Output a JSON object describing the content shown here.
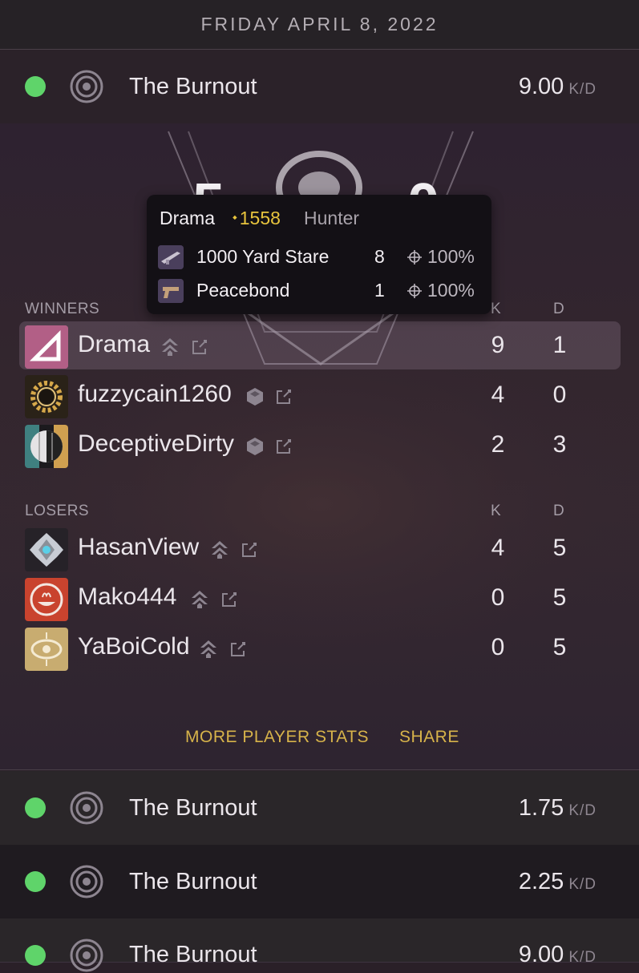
{
  "date": "FRIDAY APRIL 8, 2022",
  "activities_top": [
    {
      "map": "The Burnout",
      "kd": "9.00",
      "kd_unit": "K/D",
      "status_color": "#5fd46a"
    }
  ],
  "match": {
    "score_left": "5",
    "score_right": "0",
    "winners_label": "WINNERS",
    "losers_label": "LOSERS",
    "k_label": "K",
    "d_label": "D",
    "winners": [
      {
        "name": "Drama",
        "k": "9",
        "d": "1",
        "platform_icon": "hunter-class-icon",
        "highlighted": true
      },
      {
        "name": "fuzzycain1260",
        "k": "4",
        "d": "0",
        "platform_icon": "steam-icon",
        "highlighted": false
      },
      {
        "name": "DeceptiveDirty",
        "k": "2",
        "d": "3",
        "platform_icon": "steam-icon",
        "highlighted": false
      }
    ],
    "losers": [
      {
        "name": "HasanView",
        "k": "4",
        "d": "5",
        "platform_icon": "hunter-class-icon"
      },
      {
        "name": "Mako444",
        "k": "0",
        "d": "5",
        "platform_icon": "hunter-class-icon"
      },
      {
        "name": "YaBoiCold",
        "k": "0",
        "d": "5",
        "platform_icon": "hunter-class-icon"
      }
    ],
    "more_stats_label": "MORE PLAYER STATS",
    "share_label": "SHARE"
  },
  "tooltip": {
    "name": "Drama",
    "light": "1558",
    "light_symbol": "⬩",
    "class": "Hunter",
    "weapons": [
      {
        "name": "1000 Yard Stare",
        "kills": "8",
        "accuracy": "100%"
      },
      {
        "name": "Peacebond",
        "kills": "1",
        "accuracy": "100%"
      }
    ]
  },
  "activities_bottom": [
    {
      "map": "The Burnout",
      "kd": "1.75",
      "kd_unit": "K/D"
    },
    {
      "map": "The Burnout",
      "kd": "2.25",
      "kd_unit": "K/D"
    },
    {
      "map": "The Burnout",
      "kd": "9.00",
      "kd_unit": "K/D"
    }
  ],
  "colors": {
    "status_green": "#5fd46a",
    "gold": "#d7b34a",
    "light_level": "#e8c43d"
  }
}
